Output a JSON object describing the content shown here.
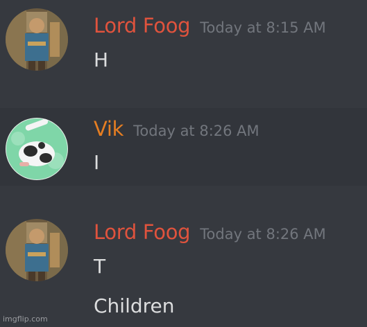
{
  "colors": {
    "background": "#36393f",
    "highlight_band": "#32353b",
    "timestamp": "#72767d",
    "message_text": "#dcddde"
  },
  "messages": [
    {
      "author": "Lord Foog",
      "author_color": "#e0533d",
      "avatar_icon": "lord-foog-avatar",
      "timestamp": "Today at 8:15 AM",
      "lines": [
        "H"
      ]
    },
    {
      "author": "Vik",
      "author_color": "#e67e22",
      "avatar_icon": "vik-avatar",
      "timestamp": "Today at 8:26 AM",
      "lines": [
        "I"
      ]
    },
    {
      "author": "Lord Foog",
      "author_color": "#e0533d",
      "avatar_icon": "lord-foog-avatar",
      "timestamp": "Today at 8:26 AM",
      "lines": [
        "T",
        "Children"
      ]
    }
  ],
  "watermark": "imgflip.com"
}
